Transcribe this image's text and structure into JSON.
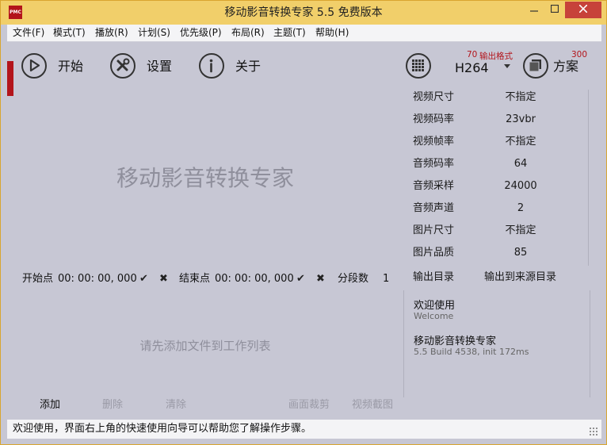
{
  "window": {
    "title": "移动影音转换专家 5.5 免费版本",
    "logo_text": "PMC"
  },
  "menu": [
    {
      "label": "文件(F)"
    },
    {
      "label": "模式(T)"
    },
    {
      "label": "播放(R)"
    },
    {
      "label": "计划(S)"
    },
    {
      "label": "优先级(P)"
    },
    {
      "label": "布局(R)"
    },
    {
      "label": "主题(T)"
    },
    {
      "label": "帮助(H)"
    }
  ],
  "toolbar": {
    "start_label": "开始",
    "settings_label": "设置",
    "about_label": "关于",
    "format_count": "70",
    "format_caption": "输出格式",
    "format_value": "H264",
    "scheme_count": "300",
    "scheme_label": "方案"
  },
  "preview": {
    "watermark": "移动影音转换专家"
  },
  "range": {
    "start_label": "开始点",
    "start_value": "00: 00: 00, 000",
    "end_label": "结束点",
    "end_value": "00: 00: 00, 000",
    "segments_label": "分段数",
    "segments_value": "1"
  },
  "file_list": {
    "empty_hint": "请先添加文件到工作列表"
  },
  "actions": {
    "add": "添加",
    "delete": "删除",
    "clear": "清除",
    "crop": "画面裁剪",
    "snapshot": "视频截图"
  },
  "properties": [
    {
      "label": "视频尺寸",
      "value": "不指定"
    },
    {
      "label": "视频码率",
      "value": "23vbr"
    },
    {
      "label": "视频帧率",
      "value": "不指定"
    },
    {
      "label": "音频码率",
      "value": "64"
    },
    {
      "label": "音频采样",
      "value": "24000"
    },
    {
      "label": "音频声道",
      "value": "2"
    },
    {
      "label": "图片尺寸",
      "value": "不指定"
    },
    {
      "label": "图片品质",
      "value": "85"
    }
  ],
  "output_dir": {
    "label": "输出目录",
    "value": "输出到来源目录"
  },
  "info": {
    "welcome_title": "欢迎使用",
    "welcome_sub": "Welcome",
    "app_name": "移动影音转换专家",
    "build": "5.5 Build 4538, init 172ms"
  },
  "status": {
    "text": "欢迎使用，界面右上角的快速使用向导可以帮助您了解操作步骤。"
  },
  "colors": {
    "accent_red": "#b3141b",
    "titlebar": "#f1cf6a",
    "client_bg": "#c7c7d4"
  }
}
